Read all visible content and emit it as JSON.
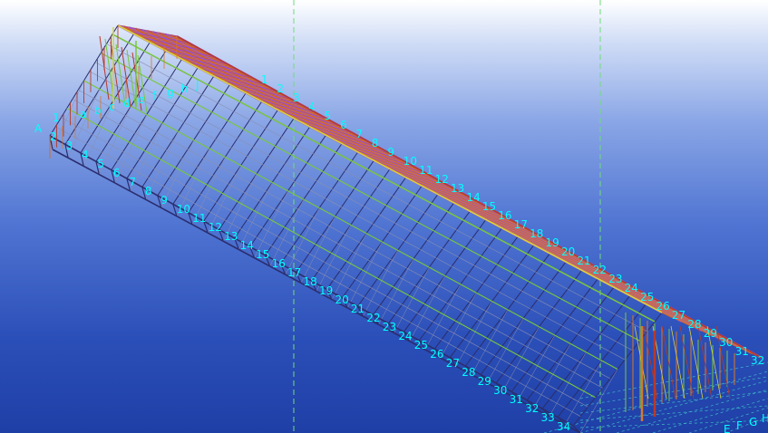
{
  "viewport": {
    "background_top": "#ffffff",
    "background_bottom": "#1e3fa6",
    "label_color": "#00ffff",
    "guide_color": "#6fdc7a",
    "colors": {
      "roof_purple": "#9b4fd1",
      "roof_red": "#c8552e",
      "frame_orange": "#d7782c",
      "frame_red": "#b83a2a",
      "frame_navy": "#2b2d6e",
      "bracing_green": "#78c83a",
      "bracing_yellow": "#d9d23a",
      "purlin_grey": "#8a8fb0"
    }
  },
  "grid_lines": {
    "ridge_axis": [
      "1",
      "2",
      "3",
      "4",
      "5",
      "6",
      "7",
      "8",
      "9",
      "10",
      "11",
      "12",
      "13",
      "14",
      "15",
      "16",
      "17",
      "18",
      "19",
      "20",
      "21",
      "22",
      "23",
      "24",
      "25",
      "26",
      "27",
      "28",
      "29",
      "30",
      "31",
      "32"
    ],
    "eave_axis": [
      "2",
      "3",
      "4",
      "5",
      "6",
      "7",
      "8",
      "9",
      "10",
      "11",
      "12",
      "13",
      "14",
      "15",
      "16",
      "17",
      "18",
      "19",
      "20",
      "21",
      "22",
      "23",
      "24",
      "25",
      "26",
      "27",
      "28",
      "29",
      "30",
      "31",
      "32",
      "33",
      "34"
    ],
    "left_end_labels": [
      "A",
      "1"
    ],
    "end_gable_labels": [
      "a",
      "b",
      "c",
      "d",
      "e",
      "f",
      "g",
      "h",
      "J"
    ],
    "right_end_labels": [
      "E",
      "F",
      "G",
      "H"
    ]
  }
}
